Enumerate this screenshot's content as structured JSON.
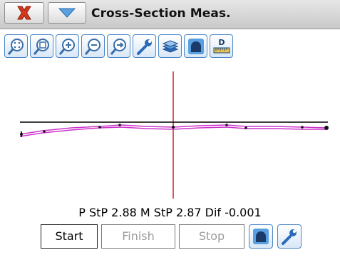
{
  "window": {
    "title": "Cross-Section Meas."
  },
  "titlebar": {
    "close_icon": "close-x-icon",
    "menu_icon": "dropdown-triangle-icon"
  },
  "toolbar": {
    "tools": [
      "zoom-extents-icon",
      "zoom-window-icon",
      "zoom-in-icon",
      "zoom-out-icon",
      "pan-icon",
      "settings-wrench-icon",
      "layers-icon",
      "tunnel-profile-icon",
      "measure-distance-icon"
    ],
    "measure_label": "D"
  },
  "readout": {
    "text": "P StP 2.88 M StP 2.87 Dif -0.001"
  },
  "buttons": {
    "start": "Start",
    "finish": "Finish",
    "stop": "Stop"
  },
  "colors": {
    "profile_line": "#cc33cc",
    "reference_line": "#000000",
    "center_line": "#cc2222",
    "accent": "#4a86c8"
  }
}
